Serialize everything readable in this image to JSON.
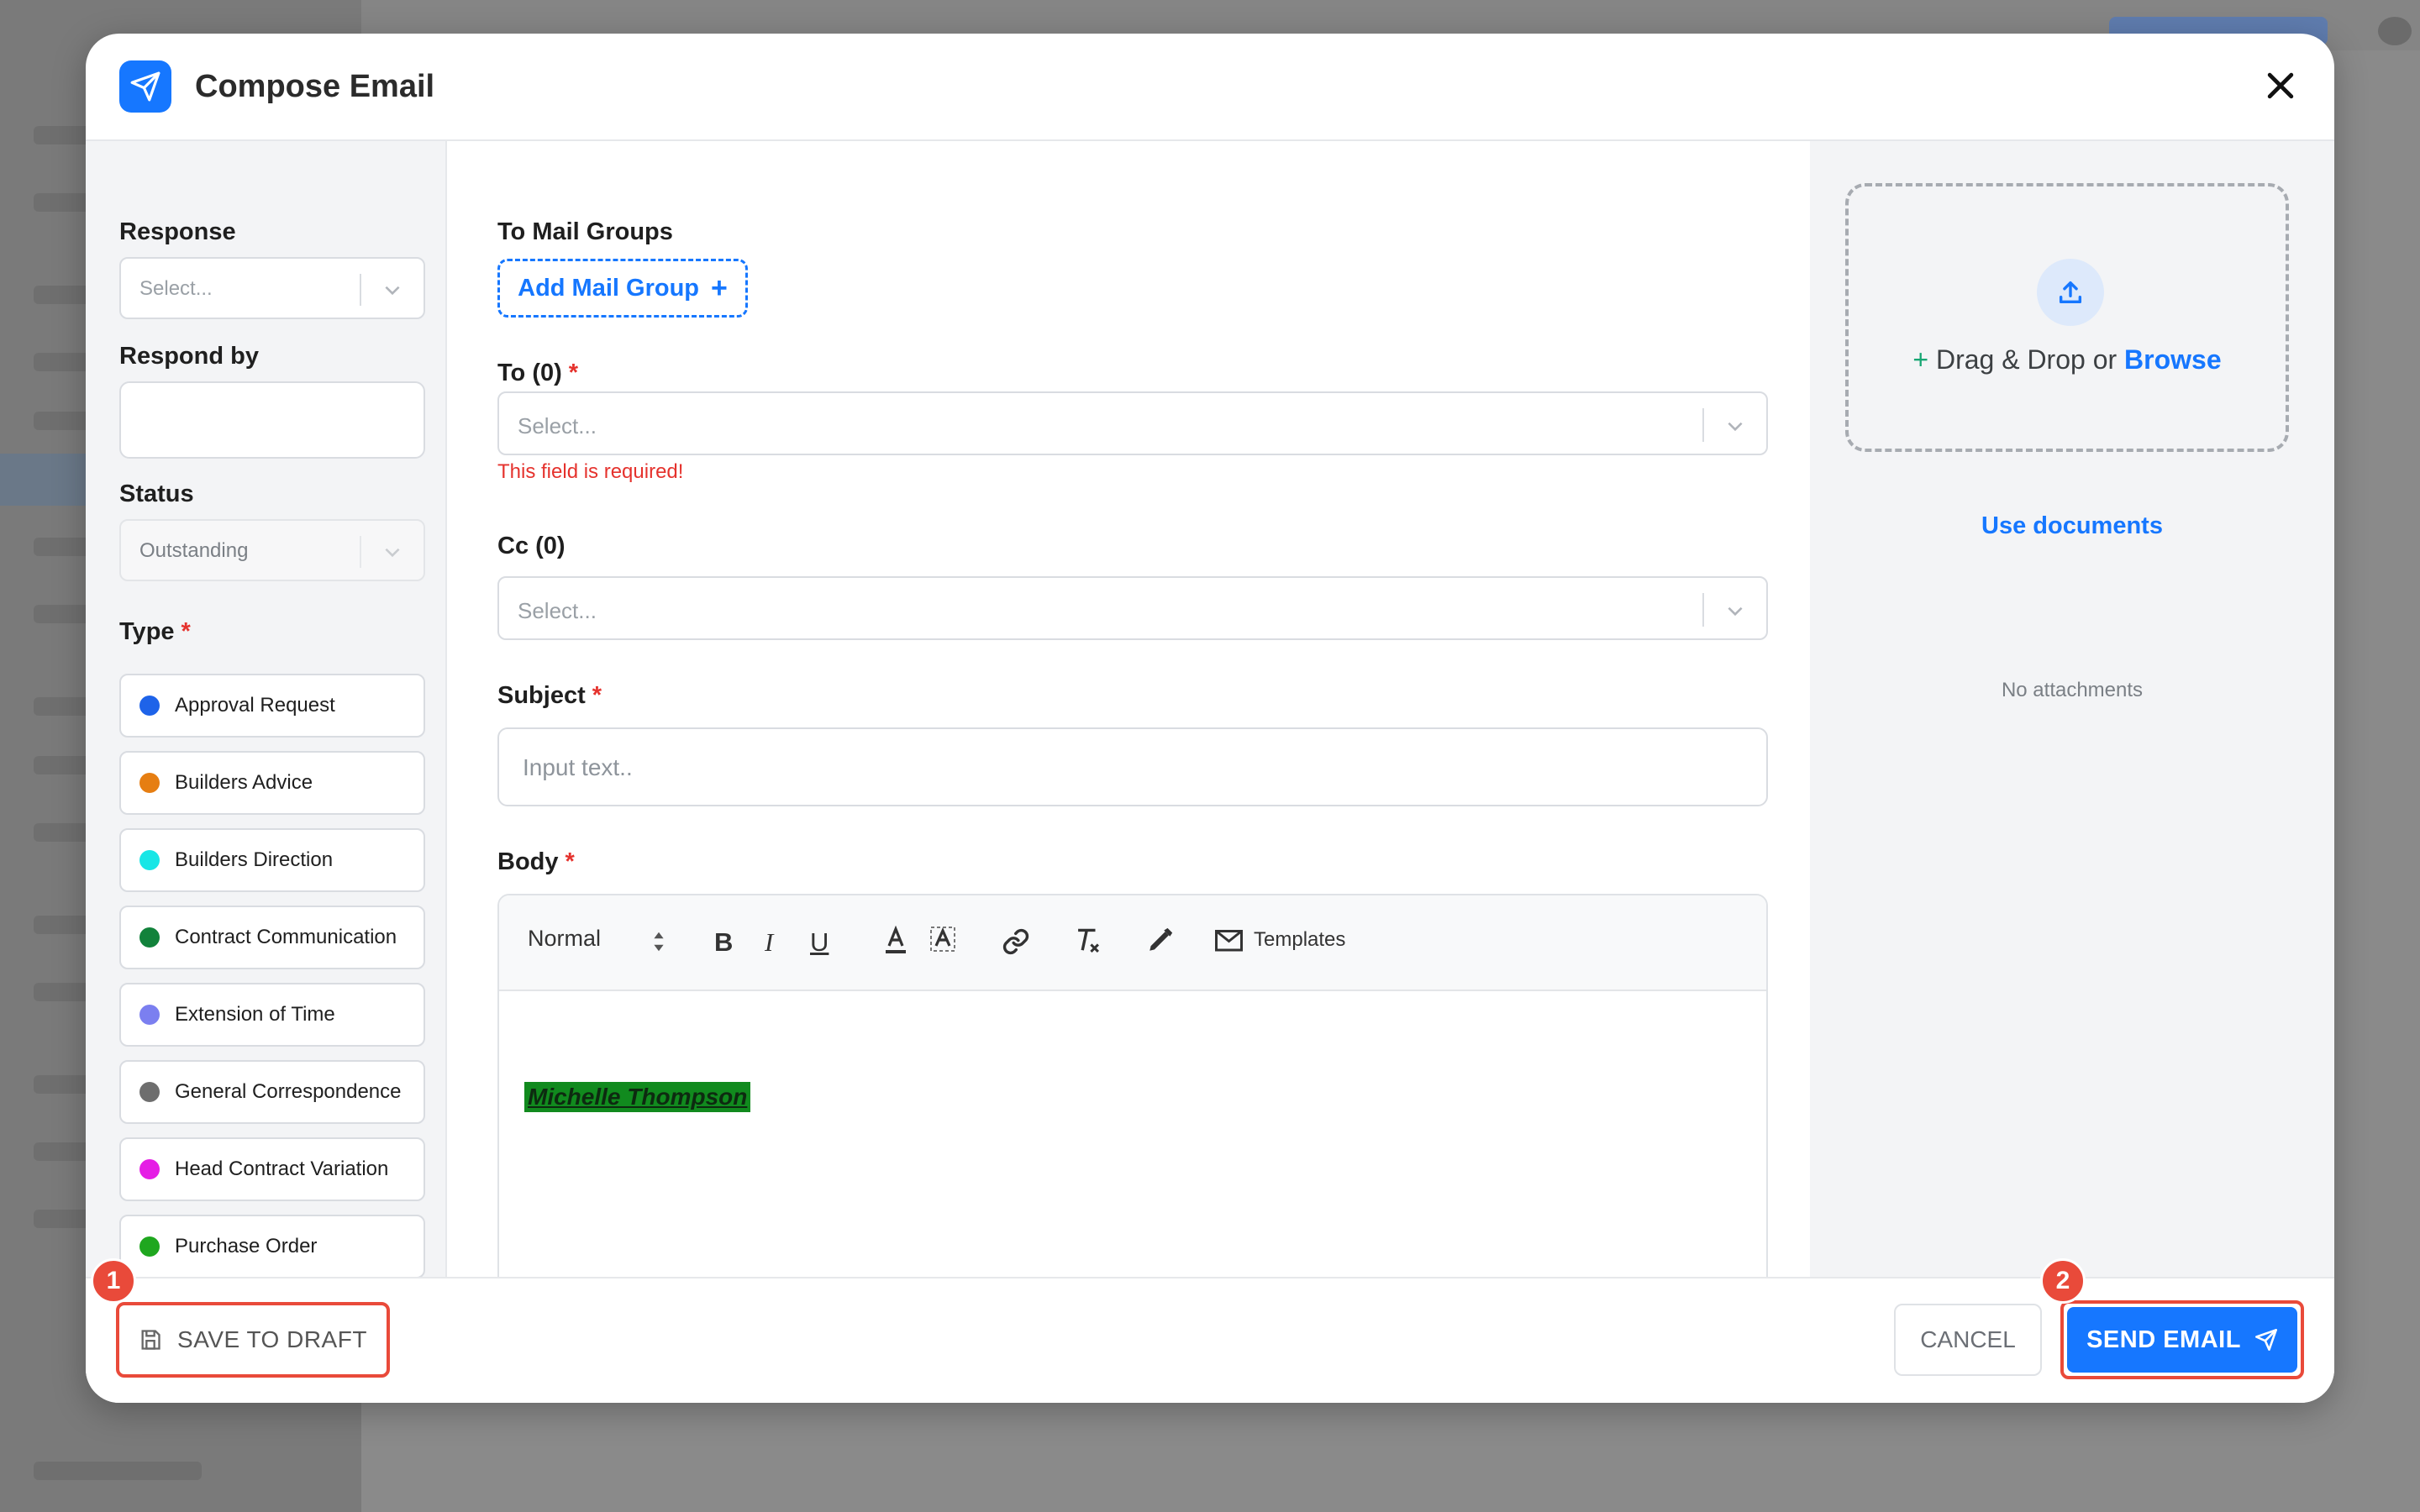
{
  "modal": {
    "title": "Compose Email",
    "icon": "paper-plane-icon"
  },
  "left": {
    "response": {
      "label": "Response",
      "placeholder": "Select..."
    },
    "respond_by": {
      "label": "Respond by",
      "value": ""
    },
    "status": {
      "label": "Status",
      "value": "Outstanding"
    },
    "type": {
      "label": "Type",
      "required_mark": "*",
      "items": [
        {
          "label": "Approval Request",
          "color": "#1e63e9"
        },
        {
          "label": "Builders Advice",
          "color": "#e67e12"
        },
        {
          "label": "Builders Direction",
          "color": "#18e6e6"
        },
        {
          "label": "Contract Communication",
          "color": "#12823b"
        },
        {
          "label": "Extension of Time",
          "color": "#7b7ff0"
        },
        {
          "label": "General Correspondence",
          "color": "#6e6e6e"
        },
        {
          "label": "Head Contract Variation",
          "color": "#e51ee5"
        },
        {
          "label": "Purchase Order",
          "color": "#1fa71f"
        }
      ]
    }
  },
  "middle": {
    "mail_groups": {
      "label": "To Mail Groups",
      "add_button": "Add Mail Group",
      "add_icon": "+"
    },
    "to": {
      "label": "To (0)",
      "required_mark": "*",
      "placeholder": "Select...",
      "error": "This field is required!"
    },
    "cc": {
      "label": "Cc (0)",
      "placeholder": "Select..."
    },
    "subject": {
      "label": "Subject",
      "required_mark": "*",
      "placeholder": "Input text.."
    },
    "body": {
      "label": "Body",
      "required_mark": "*",
      "toolbar": {
        "style_select": "Normal",
        "bold": "B",
        "italic": "I",
        "underline": "U",
        "templates": "Templates"
      },
      "signature": "Michelle Thompson"
    }
  },
  "right": {
    "drop_prefix": "+",
    "drop_text": " Drag & Drop or ",
    "browse": "Browse",
    "use_documents": "Use documents",
    "no_attachments": "No attachments"
  },
  "footer": {
    "save_draft": "SAVE TO DRAFT",
    "cancel": "CANCEL",
    "send": "SEND EMAIL",
    "badge_1": "1",
    "badge_2": "2"
  },
  "colors": {
    "accent": "#1677ff",
    "error": "#e5322d",
    "highlight": "#e94a3a"
  }
}
